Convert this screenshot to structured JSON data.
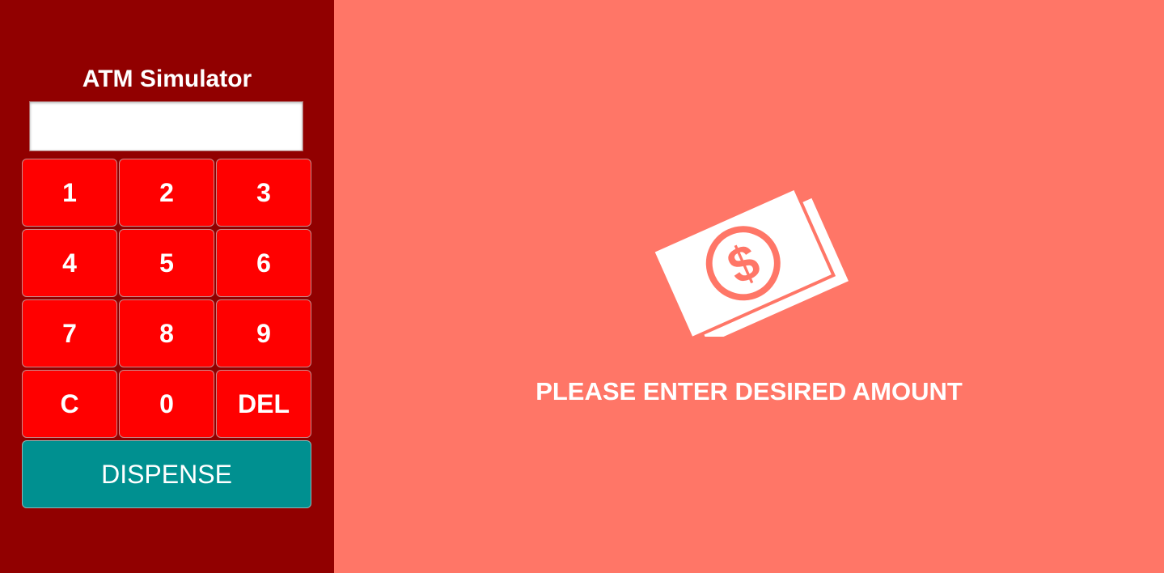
{
  "sidebar": {
    "title": "ATM Simulator",
    "amount_input": {
      "value": "",
      "placeholder": ""
    },
    "keypad": {
      "keys": [
        {
          "label": "1",
          "name": "key-1-button"
        },
        {
          "label": "2",
          "name": "key-2-button"
        },
        {
          "label": "3",
          "name": "key-3-button"
        },
        {
          "label": "4",
          "name": "key-4-button"
        },
        {
          "label": "5",
          "name": "key-5-button"
        },
        {
          "label": "6",
          "name": "key-6-button"
        },
        {
          "label": "7",
          "name": "key-7-button"
        },
        {
          "label": "8",
          "name": "key-8-button"
        },
        {
          "label": "9",
          "name": "key-9-button"
        },
        {
          "label": "C",
          "name": "clear-button"
        },
        {
          "label": "0",
          "name": "key-0-button"
        },
        {
          "label": "DEL",
          "name": "delete-button"
        }
      ]
    },
    "dispense_label": "DISPENSE"
  },
  "main": {
    "icon": "money-bills-icon",
    "message": "PLEASE ENTER DESIRED AMOUNT"
  },
  "colors": {
    "sidebar_bg": "#910000",
    "main_bg": "#ff7667",
    "key_bg": "#ff0000",
    "dispense_bg": "#009090",
    "text": "#ffffff"
  }
}
